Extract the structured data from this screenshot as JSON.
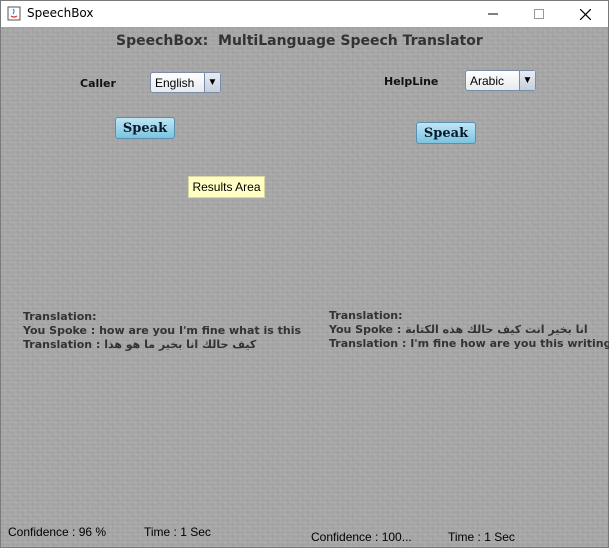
{
  "window": {
    "title": "SpeechBox"
  },
  "heading": "SpeechBox:  MultiLanguage Speech Translator",
  "caller": {
    "label": "Caller",
    "language": "English",
    "speak_label": "Speak",
    "translation_header": "Translation:",
    "you_spoke": "You Spoke : how are you I'm fine what is this",
    "translation": "Translation : كيف حالك انا بخير ما هو هذا",
    "confidence": "Confidence : 96 %",
    "time": "Time : 1 Sec"
  },
  "helpline": {
    "label": "HelpLine",
    "language": "Arabic",
    "speak_label": "Speak",
    "translation_header": "Translation:",
    "you_spoke": "You Spoke : انا بخير انت كيف حالك هذه الكتابة",
    "translation": "Translation : I'm fine how are you this writing",
    "confidence": "Confidence : 100...",
    "time": "Time : 1 Sec"
  },
  "results_area": "Results Area",
  "colors": {
    "speak_button": "#7cc4e0",
    "results_area": "#ffffc4",
    "background": "#a9a9a9"
  },
  "icons": {
    "app": "java-icon",
    "minimize": "minimize-icon",
    "maximize": "maximize-icon",
    "close": "close-icon"
  }
}
